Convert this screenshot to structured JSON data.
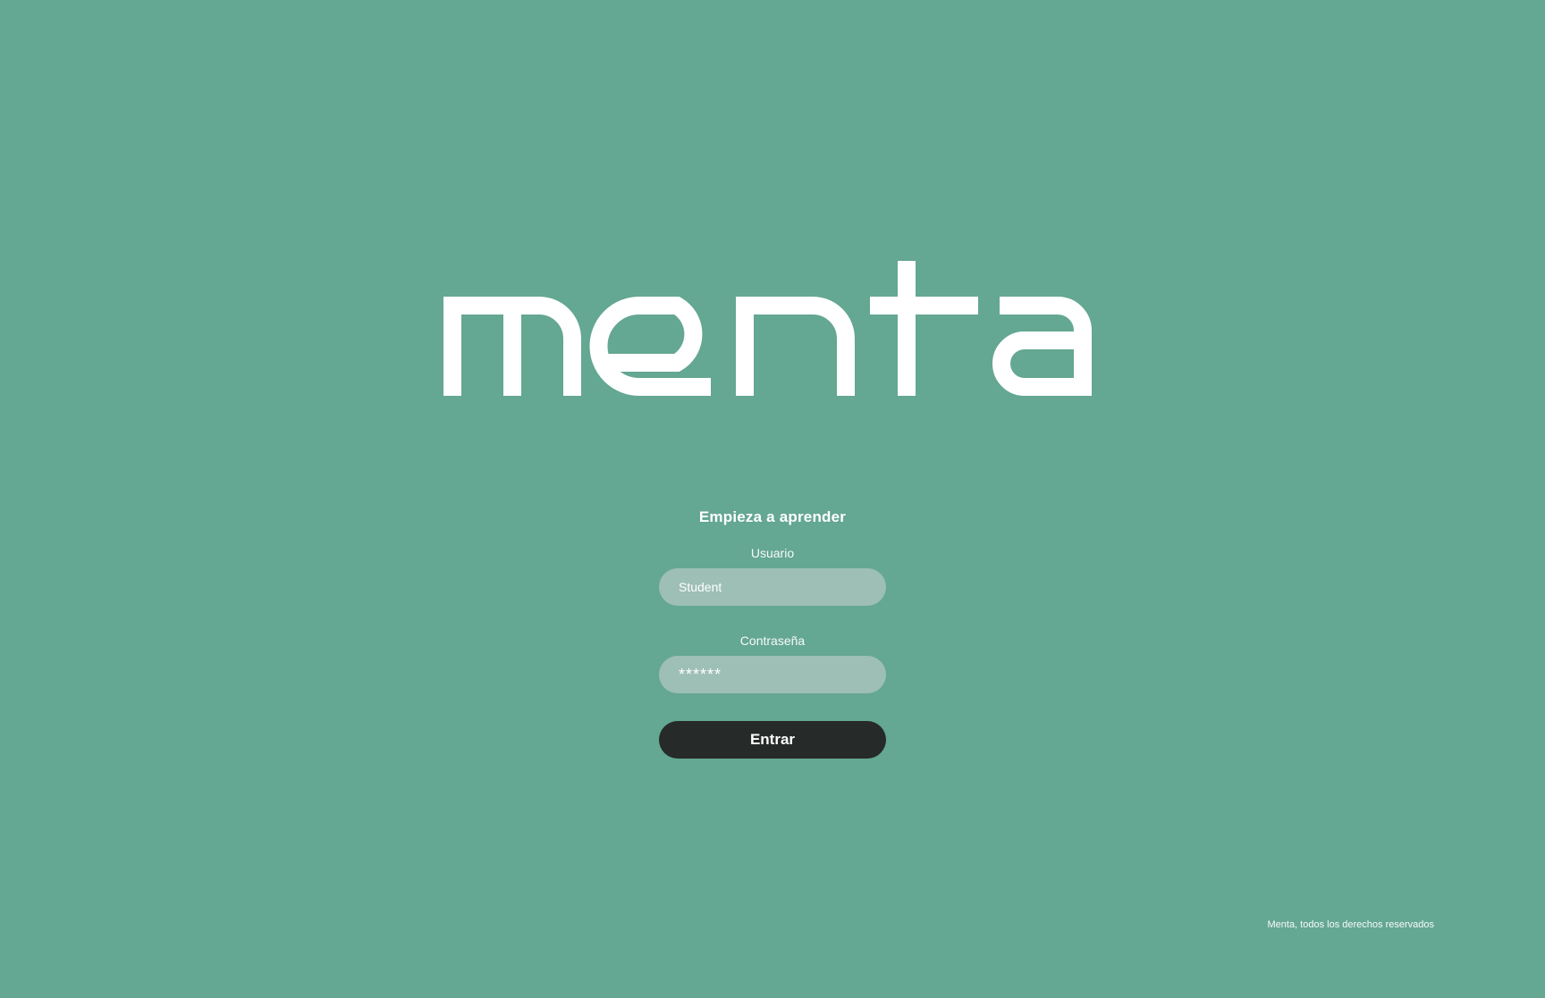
{
  "brand": {
    "logo_text": "menta"
  },
  "login": {
    "title": "Empieza a aprender",
    "username_label": "Usuario",
    "username_value": "Student",
    "password_label": "Contraseña",
    "password_value": "******",
    "submit_label": "Entrar"
  },
  "footer": {
    "copyright": "Menta, todos los derechos reservados"
  },
  "colors": {
    "background": "#64a792",
    "input_background": "#9dbfb5",
    "button_background": "#262a29",
    "text": "#ffffff"
  }
}
